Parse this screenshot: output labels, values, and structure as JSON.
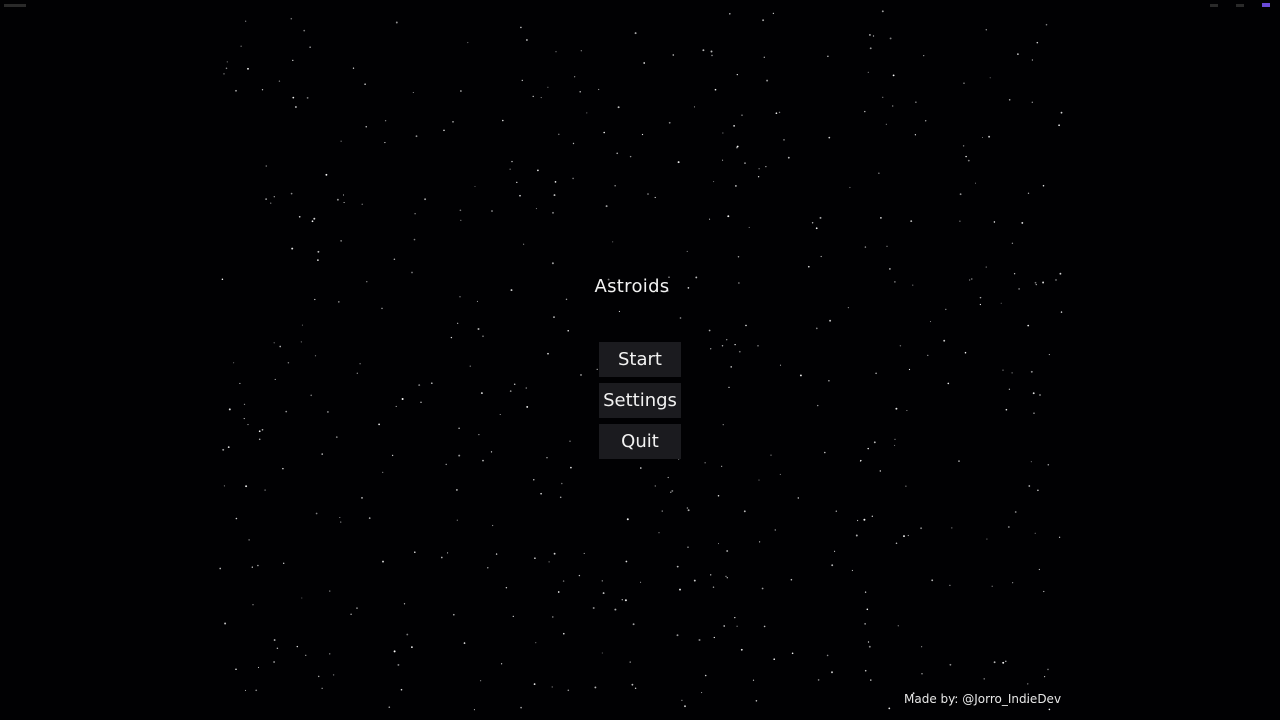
{
  "game": {
    "title": "Astroids",
    "background_color": "#010103",
    "star_color": "#ffffff"
  },
  "menu": {
    "buttons": [
      {
        "label": "Start"
      },
      {
        "label": "Settings"
      },
      {
        "label": "Quit"
      }
    ],
    "button_color": "#1b1b1f",
    "text_color": "#f2f2f2"
  },
  "footer": {
    "credit": "Made by: @Jorro_IndieDev"
  },
  "window_controls": {
    "accent_color": "#6a4ad8"
  }
}
